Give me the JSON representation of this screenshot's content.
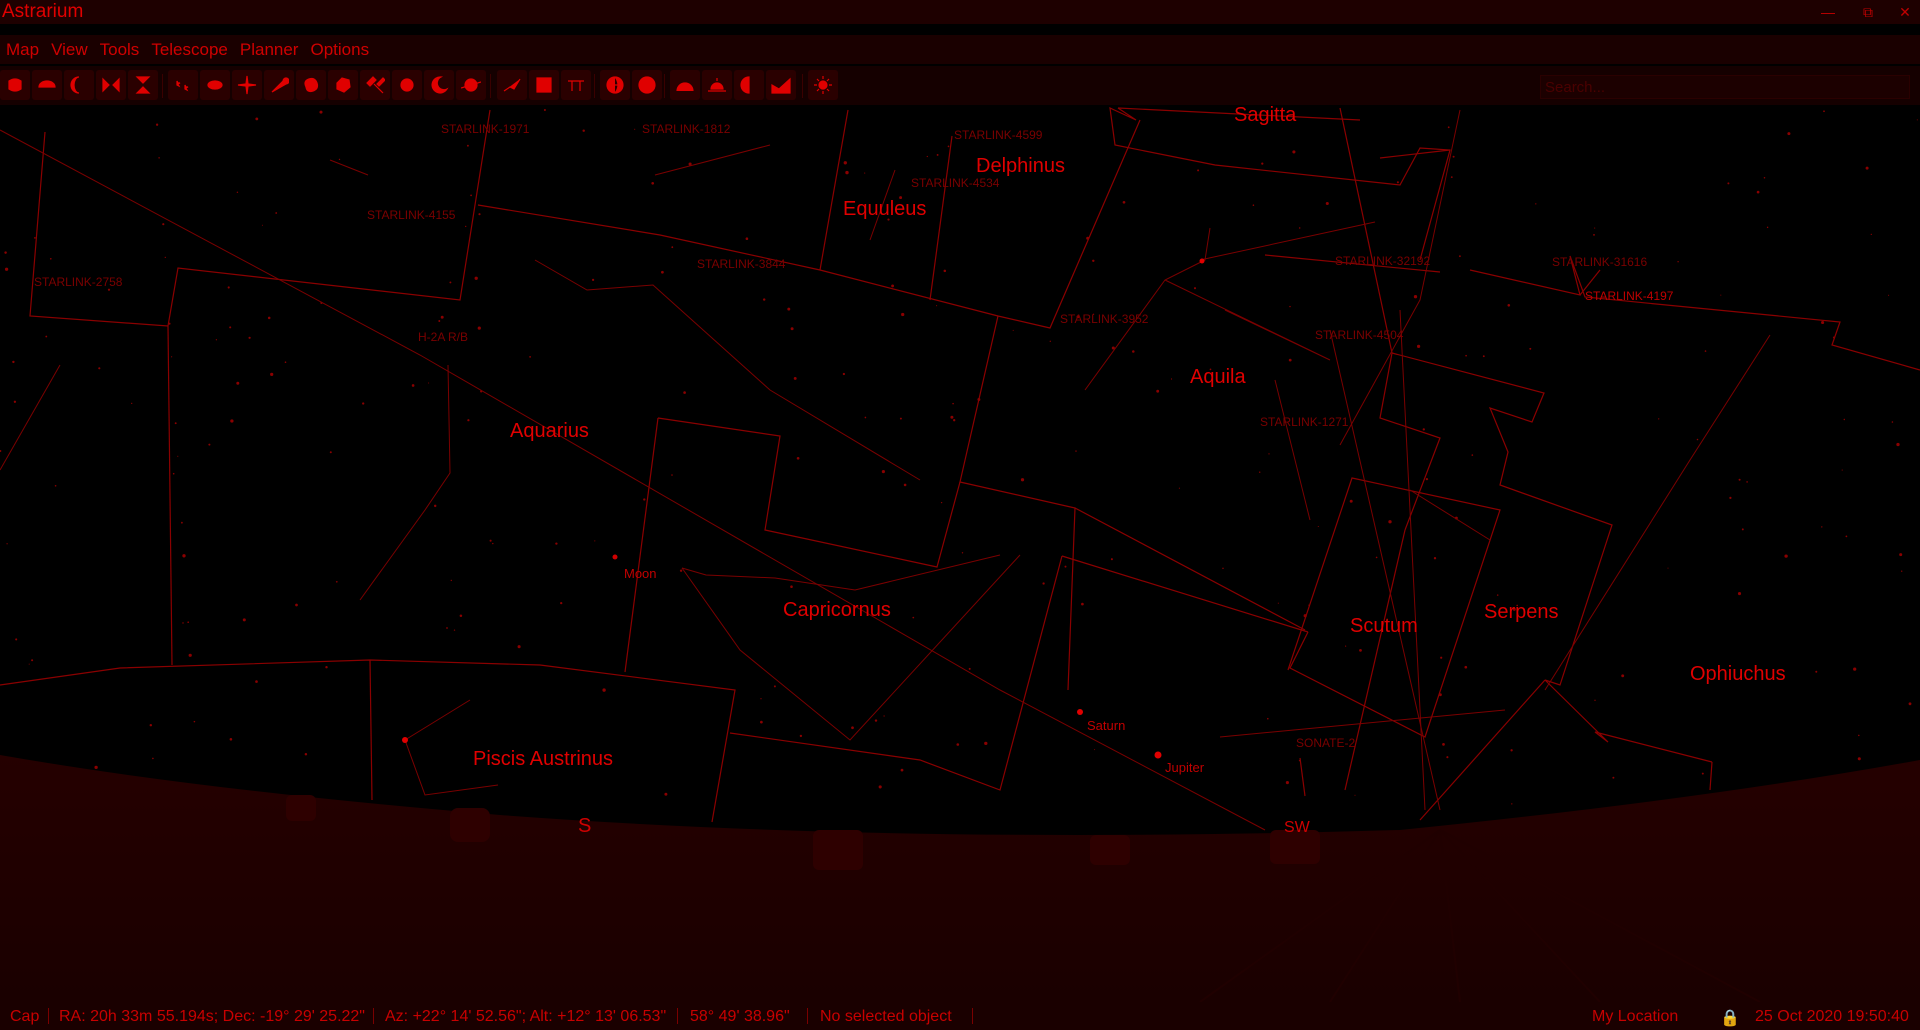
{
  "app": {
    "title": "Astrarium"
  },
  "menu": [
    "Map",
    "View",
    "Tools",
    "Telescope",
    "Planner",
    "Options"
  ],
  "toolbar": {
    "buttons": [
      "owl-icon",
      "sun-disc-icon",
      "moon-phase-icon",
      "flip-horizontal-icon",
      "flip-vertical-icon",
      "stars-icon",
      "galaxy-icon",
      "star-burst-icon",
      "comet-icon",
      "nebula-icon",
      "asteroid-icon",
      "satellite-icon",
      "sun-icon",
      "crescent-moon-icon",
      "planet-icon",
      "constellation-lines-icon",
      "constellation-borders-icon",
      "constellation-labels-icon",
      "equatorial-grid-icon",
      "horizontal-grid-icon",
      "meteor-shower-icon",
      "sunrise-icon",
      "moon-half-icon",
      "ground-icon",
      "settings-gear-icon"
    ]
  },
  "search": {
    "placeholder": "Search..."
  },
  "sky": {
    "constellations": [
      "Sagitta",
      "Delphinus",
      "Equuleus",
      "Aquila",
      "Aquarius",
      "Capricornus",
      "Scutum",
      "Serpens",
      "Ophiuchus",
      "Piscis Austrinus"
    ],
    "satellites": [
      "STARLINK-1971",
      "STARLINK-1812",
      "STARLINK-4599",
      "STARLINK-4534",
      "STARLINK-4155",
      "STARLINK-2758",
      "STARLINK-3844",
      "STARLINK-3952",
      "STARLINK-32192",
      "STARLINK-31616",
      "STARLINK-4197",
      "STARLINK-4504",
      "STARLINK-1271",
      "H-2A R/B",
      "SONATE-2"
    ],
    "bodies": [
      "Moon",
      "Saturn",
      "Jupiter"
    ],
    "directions": [
      "S",
      "SW"
    ]
  },
  "status": {
    "mode": "Cap",
    "equatorial": "RA: 20h 33m 55.194s; Dec: -19° 29' 25.22\"",
    "horizontal": "Az: +22° 14' 52.56\"; Alt: +12° 13' 06.53\"",
    "fov": "58° 49' 38.96\"",
    "selection": "No selected object",
    "location": "My Location",
    "datetime": "25 Oct 2020 19:50:40"
  },
  "colors": {
    "accent": "#d40000",
    "background": "#000000",
    "ground": "#1a0000"
  }
}
